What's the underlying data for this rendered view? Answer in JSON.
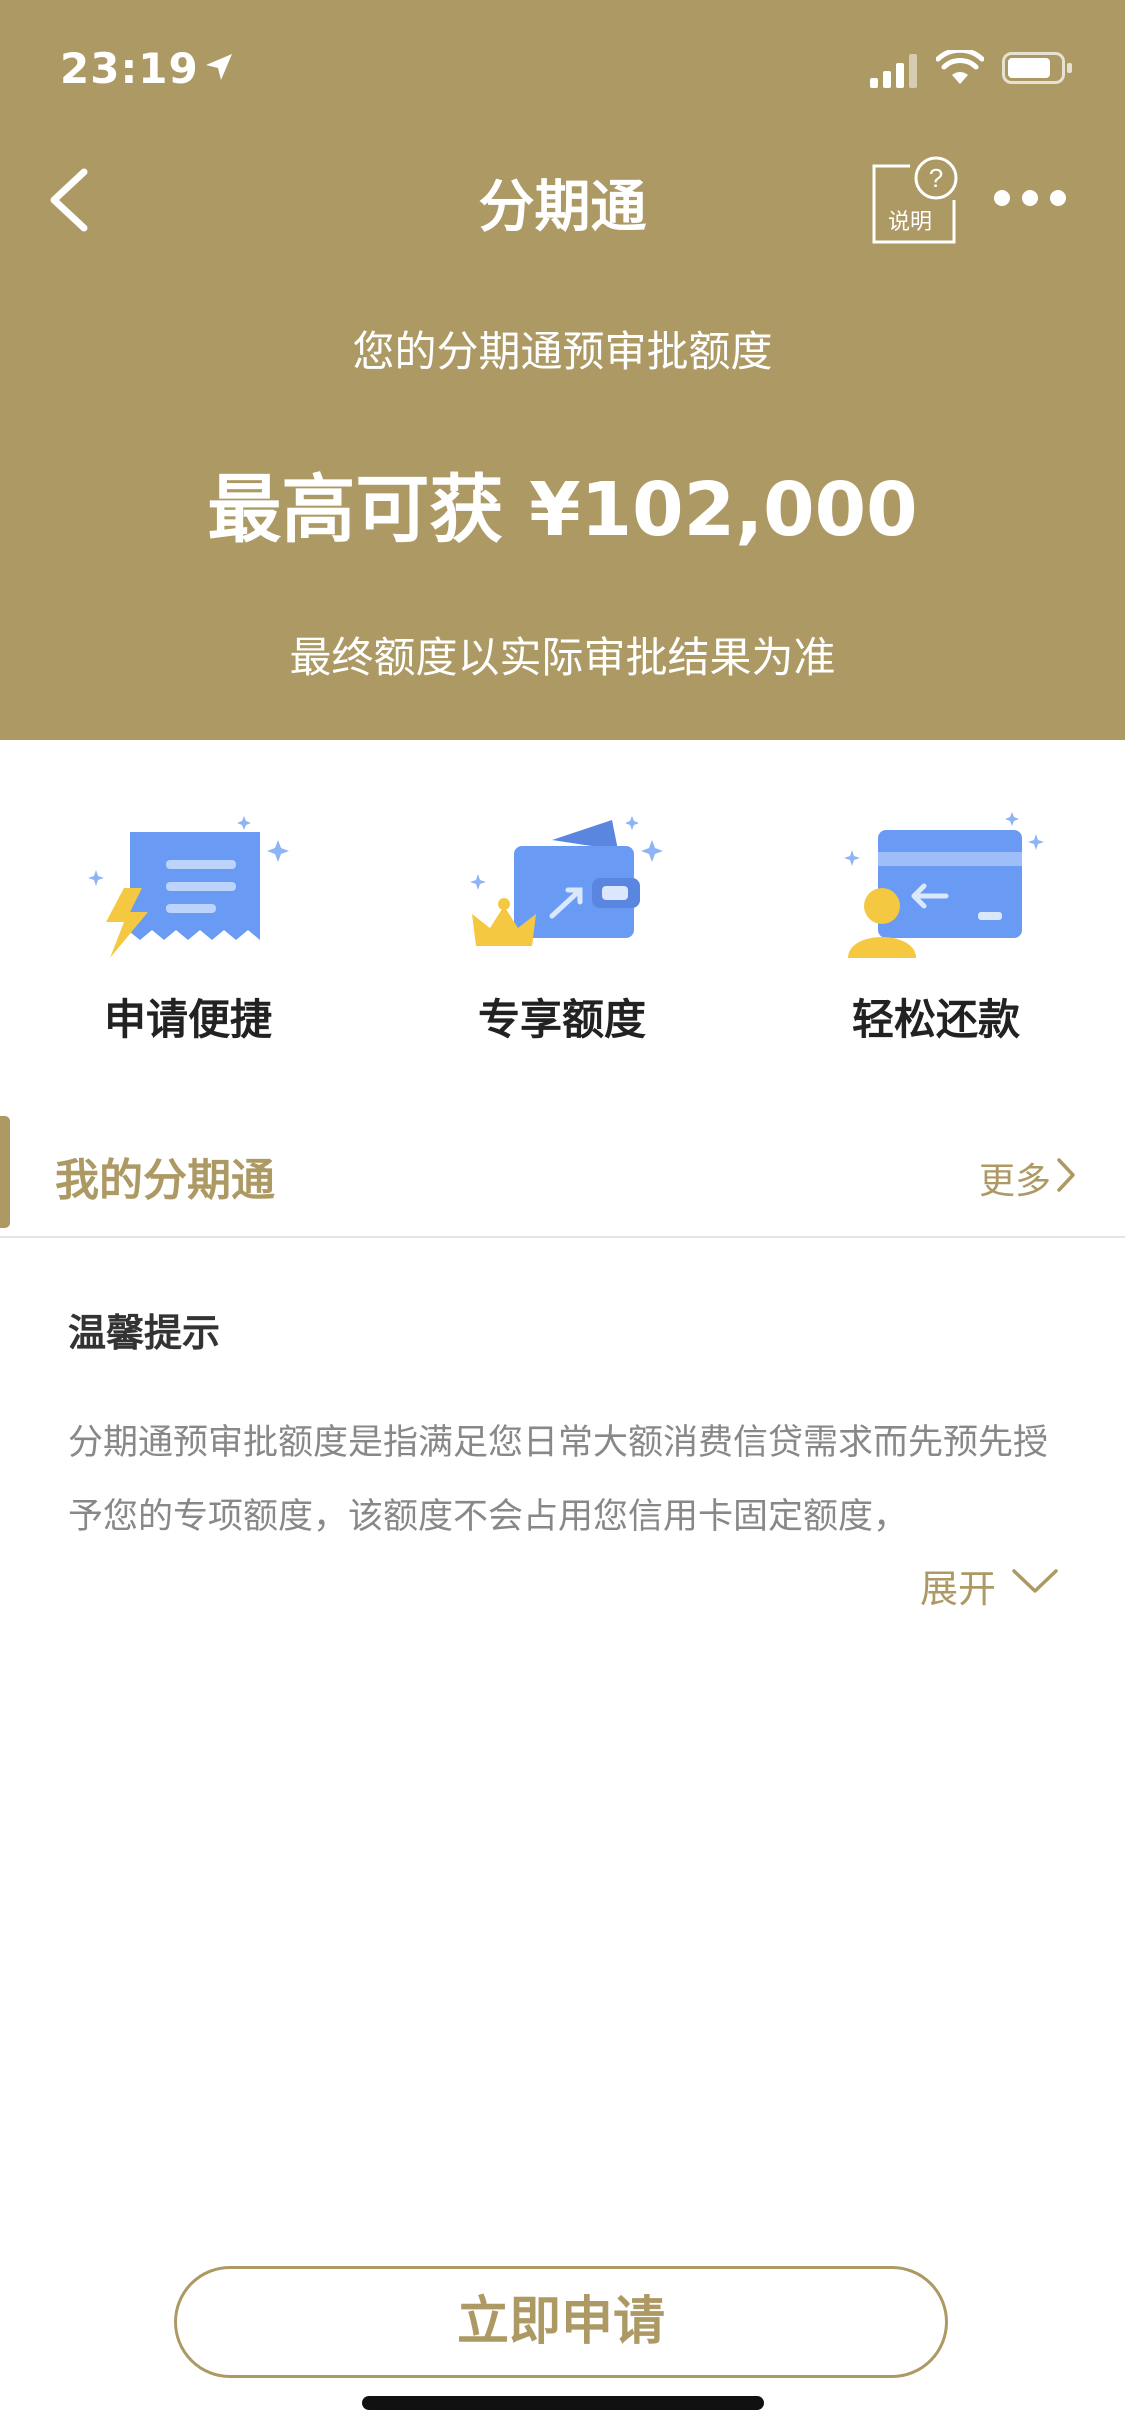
{
  "status_bar": {
    "time": "23:19"
  },
  "nav": {
    "title": "分期通",
    "help_label": "说明"
  },
  "hero": {
    "subtitle": "您的分期通预审批额度",
    "amount": "最高可获 ¥102,000",
    "note": "最终额度以实际审批结果为准"
  },
  "features": [
    {
      "label": "申请便捷",
      "icon": "receipt-lightning-icon"
    },
    {
      "label": "专享额度",
      "icon": "wallet-crown-icon"
    },
    {
      "label": "轻松还款",
      "icon": "card-user-icon"
    }
  ],
  "section": {
    "title": "我的分期通",
    "more": "更多"
  },
  "tips": {
    "title": "温馨提示",
    "text": "分期通预审批额度是指满足您日常大额消费信贷需求而先预先授予您的专项额度，该额度不会占用您信用卡固定额度，",
    "expand": "展开"
  },
  "apply_button": "立即申请",
  "colors": {
    "brand": "#ad9964",
    "icon_blue": "#6a9bf4",
    "icon_yellow": "#f5c842"
  }
}
